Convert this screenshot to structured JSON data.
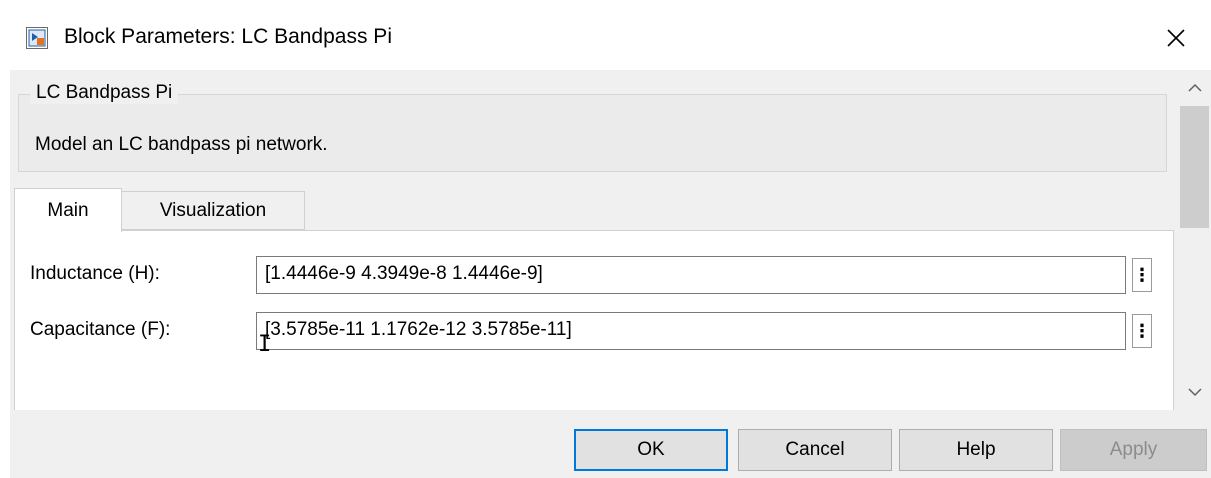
{
  "window": {
    "title": "Block Parameters: LC Bandpass Pi",
    "close_icon": "close-icon"
  },
  "group": {
    "legend": "LC Bandpass Pi",
    "description": "Model an LC bandpass pi network."
  },
  "tabs": [
    {
      "label": "Main",
      "selected": true
    },
    {
      "label": "Visualization",
      "selected": false
    }
  ],
  "params": {
    "inductance": {
      "label": "Inductance (H):",
      "value": "[1.4446e-9  4.3949e-8  1.4446e-9]"
    },
    "capacitance": {
      "label": "Capacitance (F):",
      "value": "[3.5785e-11  1.1762e-12  3.5785e-11]"
    }
  },
  "buttons": {
    "ok": "OK",
    "cancel": "Cancel",
    "help": "Help",
    "apply": "Apply"
  },
  "colors": {
    "focus_border": "#0078d7",
    "dialog_background": "#f0f0f0",
    "disabled_text": "#8c8c8c"
  }
}
